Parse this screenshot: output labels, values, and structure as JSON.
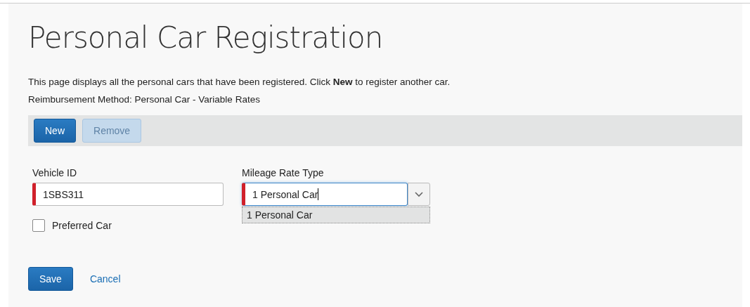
{
  "title": "Personal Car Registration",
  "intro": "This page displays all the personal cars that have been registered. Click **New** to register another car.",
  "method": "Reimbursement Method: Personal Car - Variable Rates",
  "toolbar": [
    {
      "label": "New",
      "disabled": false
    },
    {
      "label": "Remove",
      "disabled": true
    }
  ],
  "vehicle_id": {
    "label": "Vehicle ID",
    "value": "1SBS311",
    "required": true
  },
  "mileage_rate_type": {
    "label": "Mileage Rate Type",
    "value": "1 Personal Car",
    "required": true,
    "expanded": true,
    "options": [
      {
        "label": "1 Personal Car",
        "selected": true
      }
    ]
  },
  "preferred_car": {
    "label": "Preferred Car",
    "checked": false
  },
  "actions": {
    "save": "Save",
    "cancel": "Cancel"
  }
}
